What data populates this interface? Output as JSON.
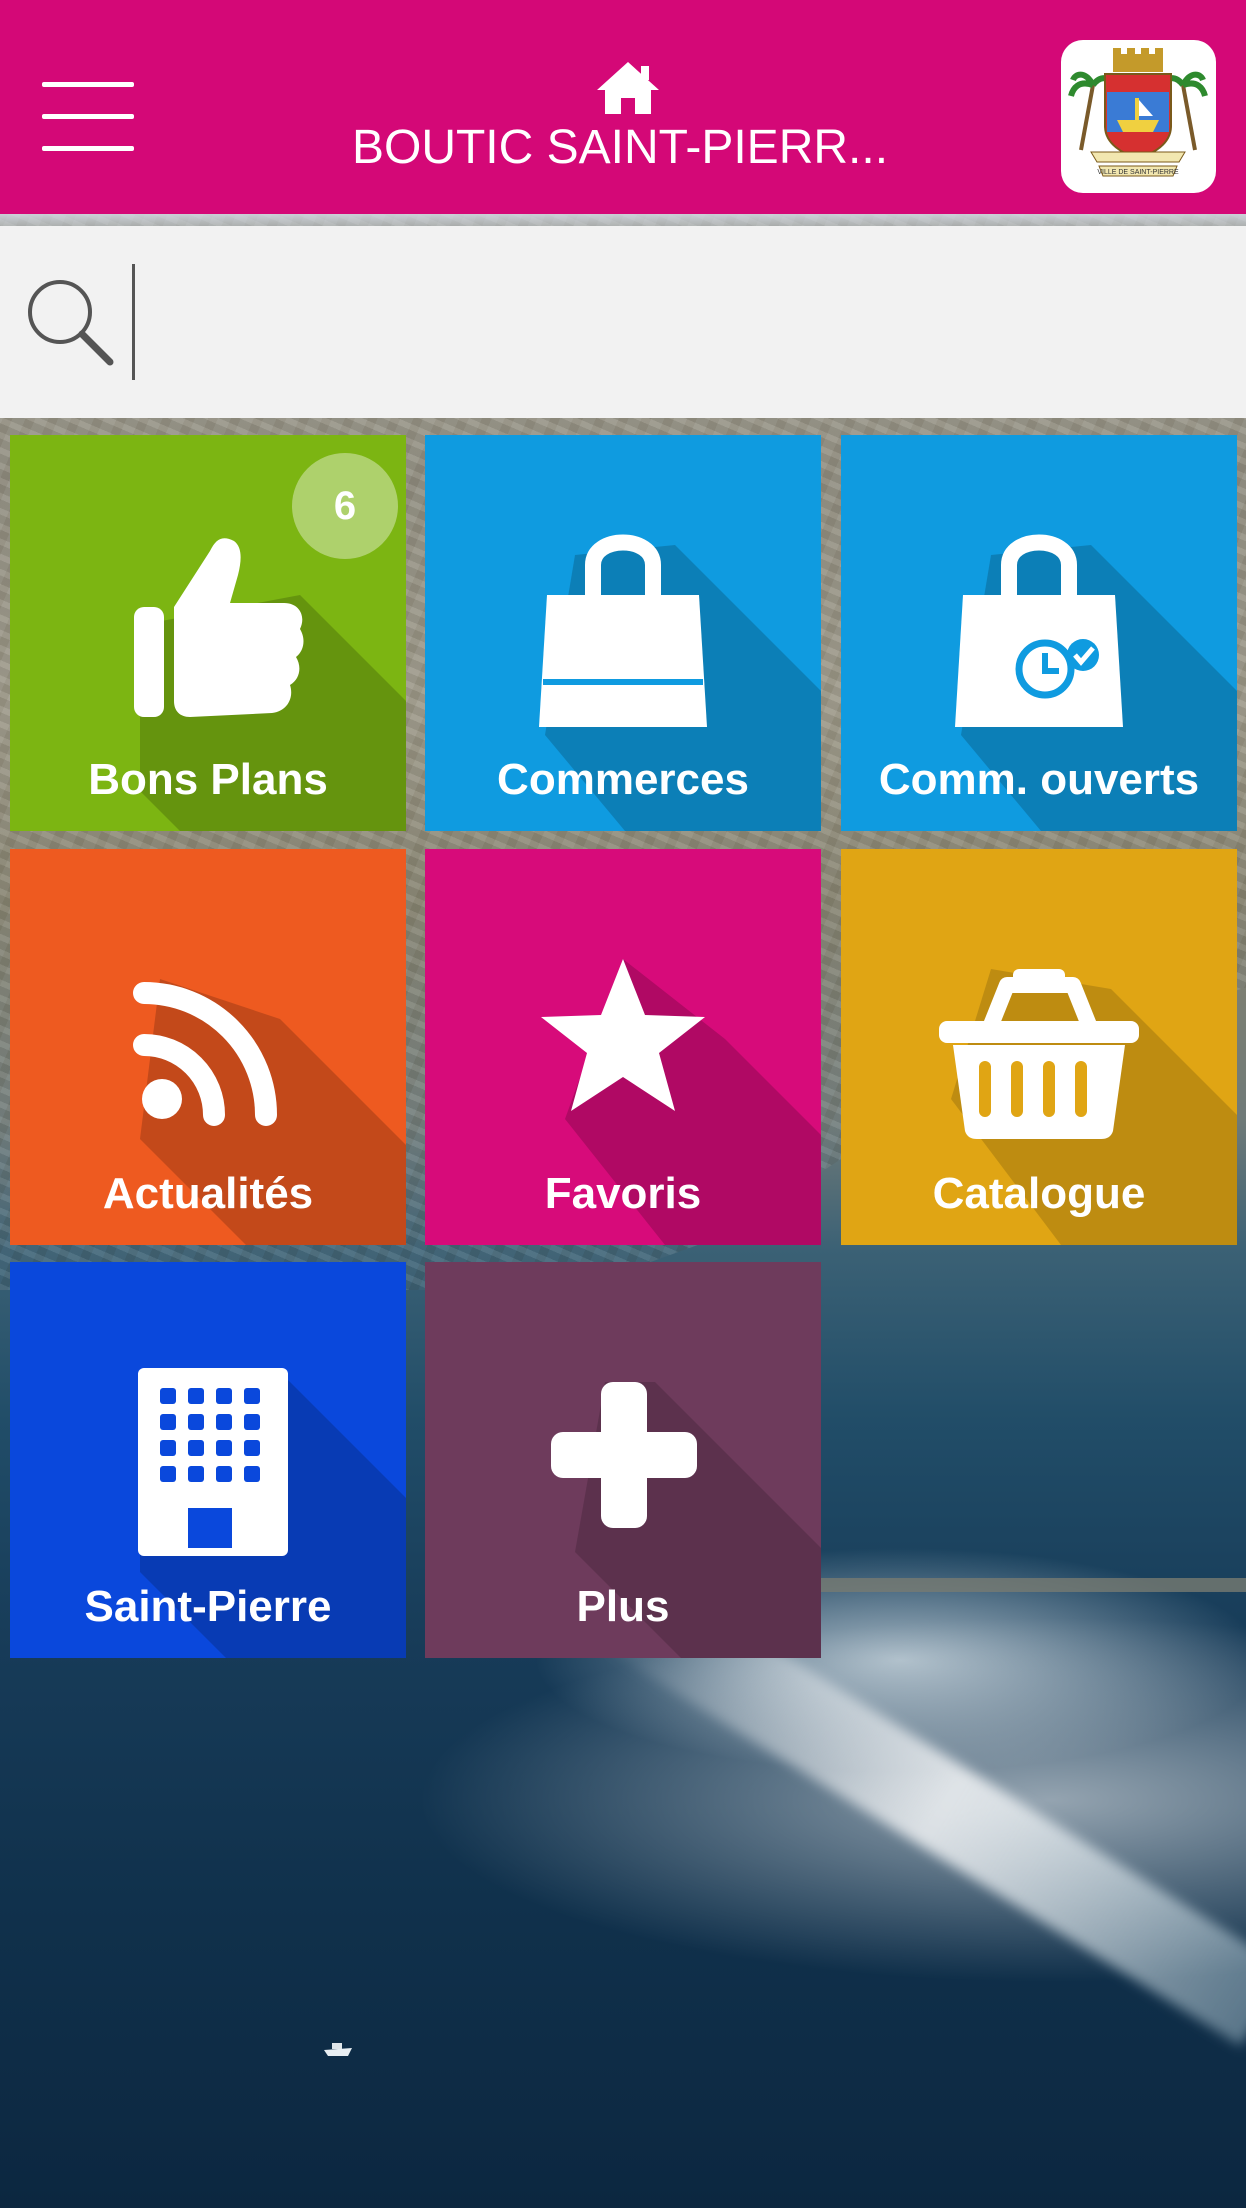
{
  "header": {
    "title": "BOUTIC SAINT-PIERR...",
    "menu_icon": "hamburger-menu-icon",
    "home_icon": "home-icon",
    "logo": "ville-de-saint-pierre-coat-of-arms",
    "logo_text": "VILLE DE SAINT-PIERRE",
    "color": "#d40877"
  },
  "search": {
    "value": "",
    "placeholder": "",
    "icon": "search-icon"
  },
  "tiles": [
    {
      "label": "Bons Plans",
      "icon": "thumbs-up-icon",
      "color": "#7cb512",
      "badge": "6"
    },
    {
      "label": "Commerces",
      "icon": "shopping-bag-icon",
      "color": "#0f9be0"
    },
    {
      "label": "Comm. ouverts",
      "icon": "shopping-bag-clock-icon",
      "color": "#0f9be0"
    },
    {
      "label": "Actualités",
      "icon": "rss-feed-icon",
      "color": "#ee5a20"
    },
    {
      "label": "Favoris",
      "icon": "star-icon",
      "color": "#d70b7a"
    },
    {
      "label": "Catalogue",
      "icon": "basket-icon",
      "color": "#e0a514"
    },
    {
      "label": "Saint-Pierre",
      "icon": "building-icon",
      "color": "#0a48dc"
    },
    {
      "label": "Plus",
      "icon": "plus-icon",
      "color": "#6e3b5c"
    }
  ]
}
